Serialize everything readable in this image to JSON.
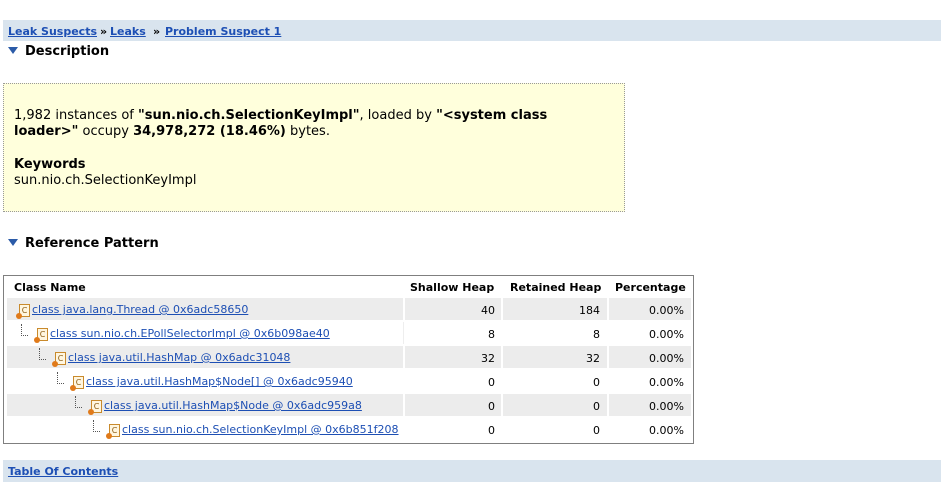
{
  "breadcrumb": {
    "items": [
      "Leak Suspects",
      "Leaks",
      "Problem Suspect 1"
    ],
    "separator": "»"
  },
  "description": {
    "heading": "Description",
    "count": "1,982",
    "text_instances_of": "instances of",
    "class_name": "\"sun.nio.ch.SelectionKeyImpl\"",
    "text_loaded_by": ", loaded by",
    "loader": "\"<system class loader>\"",
    "text_occupy": "occupy",
    "size": "34,978,272 (18.46%)",
    "text_bytes": "bytes.",
    "keywords_label": "Keywords",
    "keywords_value": "sun.nio.ch.SelectionKeyImpl"
  },
  "reference_pattern": {
    "heading": "Reference Pattern",
    "columns": [
      "Class Name",
      "Shallow Heap",
      "Retained Heap",
      "Percentage"
    ],
    "rows": [
      {
        "name": "class java.lang.Thread @ 0x6adc58650",
        "shallow": "40",
        "retained": "184",
        "percentage": "0.00%"
      },
      {
        "name": "class sun.nio.ch.EPollSelectorImpl @ 0x6b098ae40",
        "shallow": "8",
        "retained": "8",
        "percentage": "0.00%"
      },
      {
        "name": "class java.util.HashMap @ 0x6adc31048",
        "shallow": "32",
        "retained": "32",
        "percentage": "0.00%"
      },
      {
        "name": "class java.util.HashMap$Node[] @ 0x6adc95940",
        "shallow": "0",
        "retained": "0",
        "percentage": "0.00%"
      },
      {
        "name": "class java.util.HashMap$Node @ 0x6adc959a8",
        "shallow": "0",
        "retained": "0",
        "percentage": "0.00%"
      },
      {
        "name": "class sun.nio.ch.SelectionKeyImpl @ 0x6b851f208",
        "shallow": "0",
        "retained": "0",
        "percentage": "0.00%"
      }
    ],
    "icon": "class-object-icon"
  },
  "footer": {
    "toc_label": "Table Of Contents"
  },
  "colors": {
    "bar_background": "#d9e4ee",
    "link": "#1d4fb4",
    "description_background": "#ffffdc",
    "row_shade": "#ececec"
  }
}
